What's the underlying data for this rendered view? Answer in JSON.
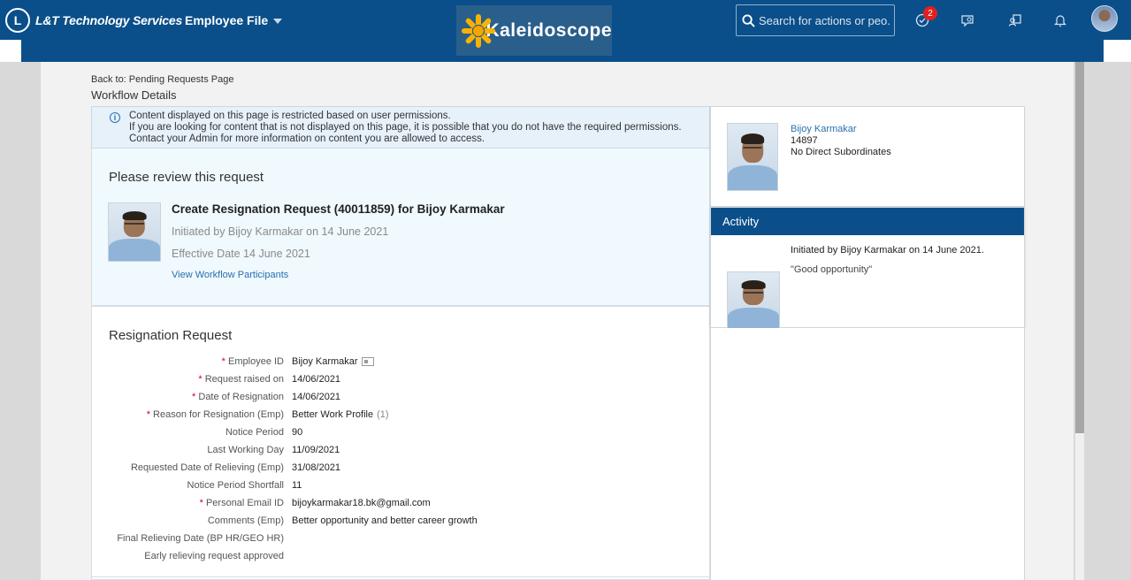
{
  "header": {
    "company": "L&T Technology Services",
    "module": "Employee File",
    "portal_logo": "Kaleidoscope",
    "search_placeholder": "Search for actions or peo...",
    "todo_badge": "2",
    "colors": {
      "shell": "#0a4f8a",
      "accent_link": "#2a6fb0",
      "required": "#d0021b",
      "badge": "#e02020"
    },
    "icons": [
      "search-icon",
      "todo-icon",
      "feedback-icon",
      "people-icon",
      "notification-bell-icon",
      "user-avatar"
    ]
  },
  "nav": {
    "back_link": "Back to: Pending Requests Page",
    "page_title": "Workflow Details"
  },
  "notice": {
    "line1": "Content displayed on this page is restricted based on user permissions.",
    "line2": "If you are looking for content that is not displayed on this page, it is possible that you do not have the required permissions.",
    "line3": "Contact your Admin for more information on content you are allowed to access."
  },
  "review": {
    "heading": "Please review this request",
    "title": "Create Resignation Request (40011859) for Bijoy Karmakar",
    "initiated": "Initiated by Bijoy Karmakar on 14 June 2021",
    "effective": "Effective Date  14 June 2021",
    "participants_link": "View Workflow Participants"
  },
  "resignation": {
    "heading": "Resignation Request",
    "fields": [
      {
        "label": "Employee ID",
        "required": true,
        "value": "Bijoy Karmakar"
      },
      {
        "label": "Request raised on",
        "required": true,
        "value": "14/06/2021"
      },
      {
        "label": "Date of Resignation",
        "required": true,
        "value": "14/06/2021"
      },
      {
        "label": "Reason for Resignation (Emp)",
        "required": true,
        "value": "Better Work Profile",
        "suffix": "(1)"
      },
      {
        "label": "Notice Period",
        "required": false,
        "value": "90"
      },
      {
        "label": "Last Working Day",
        "required": false,
        "value": "11/09/2021"
      },
      {
        "label": "Requested Date of Relieving (Emp)",
        "required": false,
        "value": "31/08/2021"
      },
      {
        "label": "Notice Period Shortfall",
        "required": false,
        "value": "11"
      },
      {
        "label": "Personal Email ID",
        "required": true,
        "value": "bijoykarmakar18.bk@gmail.com"
      },
      {
        "label": "Comments (Emp)",
        "required": false,
        "value": "Better opportunity and better career growth"
      },
      {
        "label": "Final Relieving Date (BP HR/GEO HR)",
        "required": false,
        "value": ""
      },
      {
        "label": "Early relieving request approved",
        "required": false,
        "value": ""
      }
    ]
  },
  "profile": {
    "name": "Bijoy Karmakar",
    "id": "14897",
    "subordinates": "No Direct Subordinates"
  },
  "activity": {
    "heading": "Activity",
    "entry": "Initiated by Bijoy Karmakar on 14 June 2021.",
    "comment": "\"Good opportunity\""
  }
}
